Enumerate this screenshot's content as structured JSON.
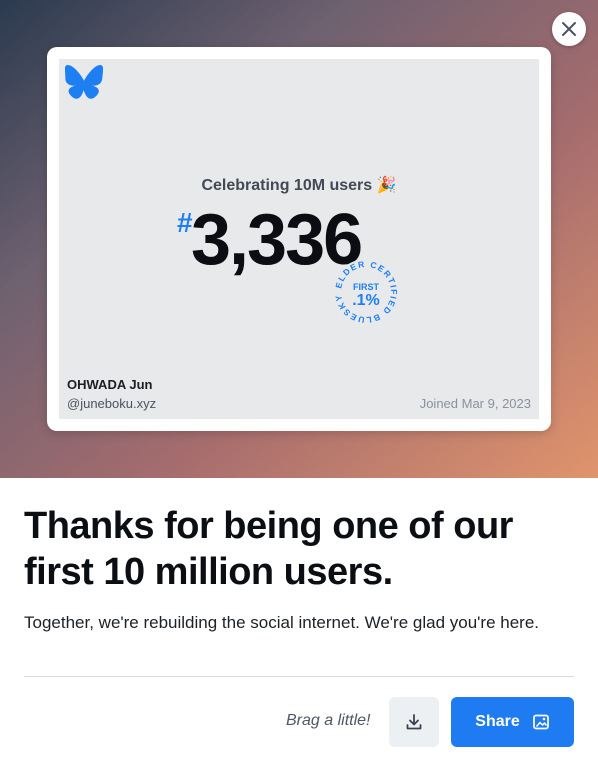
{
  "card": {
    "celebrating_text": "Celebrating 10M users 🎉",
    "hash_symbol": "#",
    "user_number": "3,336",
    "badge": {
      "ring_text": "ELDER CERTIFIED BLUESKY",
      "first_label": "FIRST",
      "fraction_label": ".1%"
    },
    "display_name": "OHWADA Jun",
    "handle": "@juneboku.xyz",
    "joined": "Joined Mar 9, 2023"
  },
  "main": {
    "headline": "Thanks for being one of our first 10 million users.",
    "subtext": "Together, we're rebuilding the social internet. We're glad you're here."
  },
  "actions": {
    "brag_label": "Brag a little!",
    "share_label": "Share"
  },
  "icons": {
    "close": "close-icon",
    "logo": "bluesky-butterfly-logo",
    "download": "download-icon",
    "share": "image-share-icon"
  },
  "colors": {
    "accent": "#1f7bf1",
    "brand_blue": "#1e7ff3",
    "card_bg": "#e8e9eb"
  }
}
